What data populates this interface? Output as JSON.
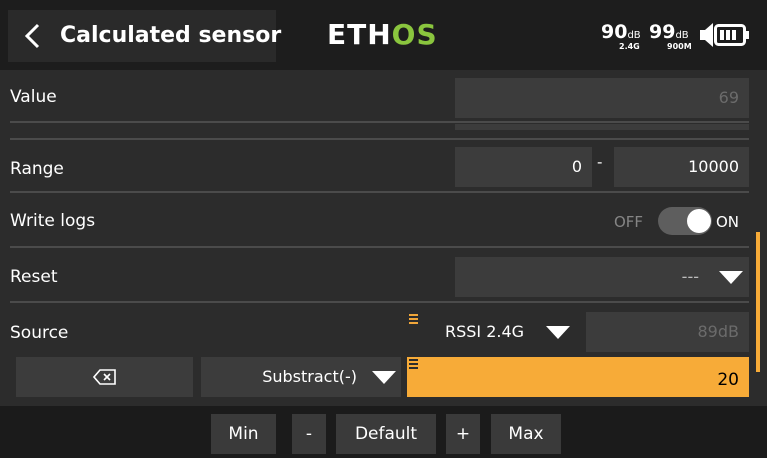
{
  "header": {
    "title": "Calculated sensor",
    "logo": {
      "part1": "ETH",
      "part2": "OS"
    },
    "rssi_2g": {
      "value": "90",
      "unit": "dB",
      "band": "2.4G"
    },
    "rssi_900": {
      "value": "99",
      "unit": "dB",
      "band": "900M"
    },
    "colors": {
      "logo_accent": "#8ac53e",
      "background": "#1d1d1d"
    }
  },
  "rows": {
    "value": {
      "label": "Value",
      "field": "69"
    },
    "range": {
      "label": "Range",
      "min": "0",
      "separator": "-",
      "max": "10000"
    },
    "write_logs": {
      "label": "Write logs",
      "off_label": "OFF",
      "on_label": "ON",
      "state": "on"
    },
    "reset": {
      "label": "Reset",
      "value": "---"
    },
    "source": {
      "label": "Source",
      "source_name": "RSSI 2.4G",
      "source_value": "89dB"
    }
  },
  "operation": {
    "clear_icon": "backspace-icon",
    "operator": "Substract(-)",
    "operand": "20",
    "operand_bg": "#f7ab38"
  },
  "bottom_bar": {
    "min": "Min",
    "minus": "-",
    "default": "Default",
    "plus": "+",
    "max": "Max"
  }
}
